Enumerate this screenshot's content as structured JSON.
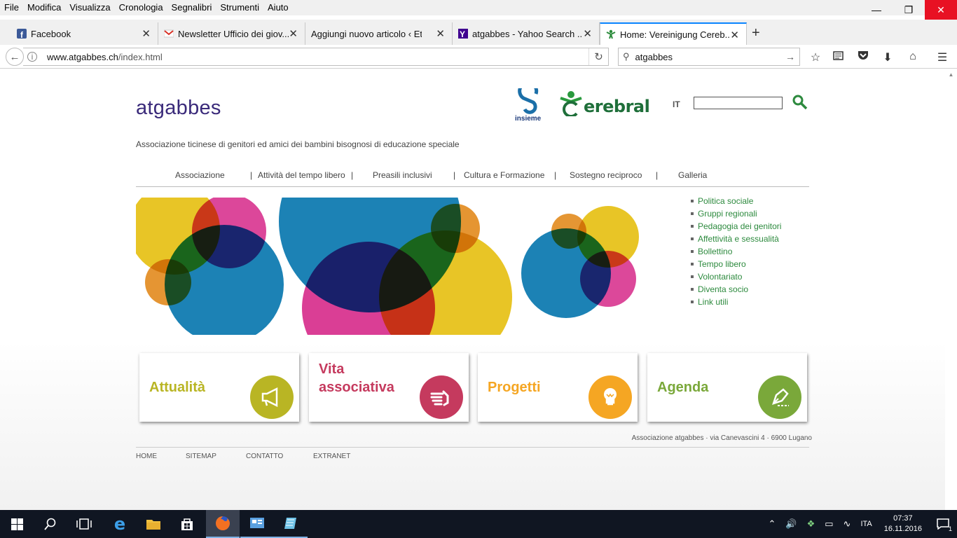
{
  "menubar": {
    "items": [
      {
        "label": "File"
      },
      {
        "label": "Modifica"
      },
      {
        "label": "Visualizza"
      },
      {
        "label": "Cronologia"
      },
      {
        "label": "Segnalibri"
      },
      {
        "label": "Strumenti"
      },
      {
        "label": "Aiuto"
      }
    ]
  },
  "tabs": [
    {
      "label": "Facebook",
      "icon": "facebook-icon"
    },
    {
      "label": "Newsletter Ufficio dei giov...",
      "icon": "gmail-icon"
    },
    {
      "label": "Aggiungi nuovo articolo ‹ Etici...",
      "icon": "none"
    },
    {
      "label": "atgabbes - Yahoo Search ...",
      "icon": "yahoo-icon"
    },
    {
      "label": "Home: Vereinigung Cereb...",
      "icon": "cerebral-icon",
      "active": true
    }
  ],
  "navbar": {
    "url_domain": "www.atgabbes.ch",
    "url_path": "/index.html",
    "search_value": "atgabbes"
  },
  "site": {
    "logo": "atgabbes",
    "tagline": "Associazione ticinese di genitori ed amici dei bambini bisognosi di educazione speciale",
    "partner1": "insieme",
    "partner2": "erebral",
    "lang": "IT",
    "nav": [
      "Associazione",
      "Attività del tempo libero",
      "Preasili inclusivi",
      "Cultura e Formazione",
      "Sostegno reciproco",
      "Galleria"
    ],
    "nav_sep": "|",
    "sidelinks": [
      "Politica sociale",
      "Gruppi regionali",
      "Pedagogia dei genitori",
      "Affettività e sessualità",
      "Bollettino",
      "Tempo libero",
      "Volontariato",
      "Diventa socio",
      "Link utili"
    ],
    "cards": [
      {
        "title": "Attualità",
        "color": "#b9b524",
        "icon": "megaphone-icon"
      },
      {
        "title": "Vita associativa",
        "title_line1": "Vita",
        "title_line2": "associativa",
        "color": "#c53a5e",
        "icon": "hand-icon"
      },
      {
        "title": "Progetti",
        "color": "#f5a623",
        "icon": "lightbulb-icon"
      },
      {
        "title": "Agenda",
        "color": "#7aa83a",
        "icon": "pen-icon"
      }
    ],
    "address": "Associazione atgabbes · via Canevascini 4 · 6900 Lugano",
    "footer_links": [
      "HOME",
      "SITEMAP",
      "CONTATTO",
      "EXTRANET"
    ]
  },
  "taskbar": {
    "lang": "ITA",
    "time": "07:37",
    "date": "16.11.2016",
    "notifications": "1"
  },
  "colors": {
    "accent_green": "#2d8a3e",
    "taskbar": "#101622",
    "close_red": "#e81123"
  }
}
